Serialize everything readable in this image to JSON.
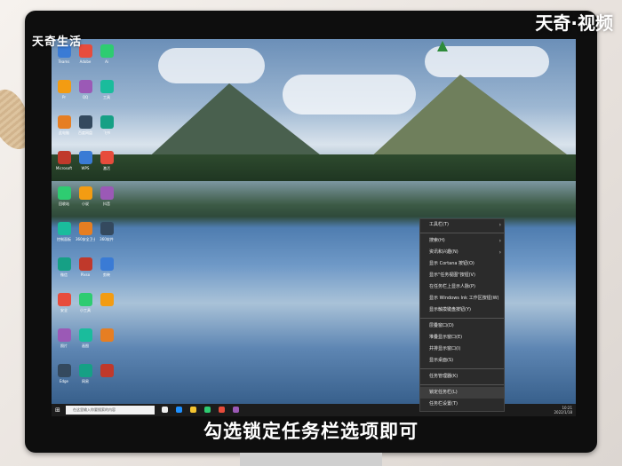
{
  "watermark": {
    "left": "天奇生活",
    "right": "天奇·视频"
  },
  "caption": "勾选锁定任务栏选项即可",
  "desktop_icons": [
    [
      "Teams",
      "Adobe",
      "Ai"
    ],
    [
      "Pr",
      "QQ",
      "工具"
    ],
    [
      "此电脑",
      "百度网盘",
      "飞书"
    ],
    [
      "Microsoft",
      "WPS",
      "激活"
    ],
    [
      "回收站",
      "小说",
      "抖音"
    ],
    [
      "控制面板",
      "360安全卫士",
      "360软件"
    ],
    [
      "微信",
      "Pixso",
      "剪映"
    ],
    [
      "安全",
      "小工具",
      ""
    ],
    [
      "照片",
      "画图",
      ""
    ],
    [
      "Edge",
      "网易",
      ""
    ]
  ],
  "context_menu": {
    "items": [
      {
        "label": "工具栏(T)",
        "submenu": true
      },
      {
        "sep": true
      },
      {
        "label": "搜索(H)",
        "submenu": true
      },
      {
        "label": "资讯和兴趣(N)",
        "submenu": true
      },
      {
        "label": "显示 Cortana 按钮(O)"
      },
      {
        "label": "显示\"任务视图\"按钮(V)"
      },
      {
        "label": "在任务栏上显示人脉(P)"
      },
      {
        "label": "显示 Windows Ink 工作区按钮(W)"
      },
      {
        "label": "显示触摸键盘按钮(Y)"
      },
      {
        "sep": true
      },
      {
        "label": "层叠窗口(D)"
      },
      {
        "label": "堆叠显示窗口(E)"
      },
      {
        "label": "并排显示窗口(I)"
      },
      {
        "label": "显示桌面(S)"
      },
      {
        "sep": true
      },
      {
        "label": "任务管理器(K)"
      },
      {
        "sep": true
      },
      {
        "label": "锁定任务栏(L)",
        "highlight": true
      },
      {
        "label": "任务栏设置(T)"
      }
    ]
  },
  "taskbar": {
    "search_placeholder": "在这里输入你要搜索的内容",
    "time": "10:21",
    "date": "2022/1/18"
  }
}
